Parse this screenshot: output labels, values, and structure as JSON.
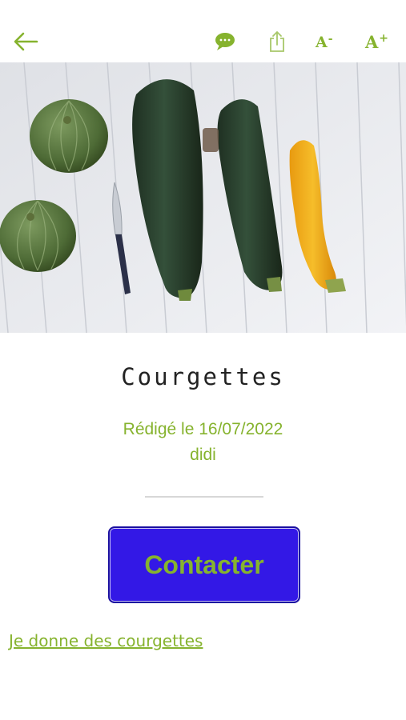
{
  "toolbar": {
    "font_smaller": "A",
    "font_smaller_sup": "-",
    "font_larger": "A",
    "font_larger_sup": "+"
  },
  "colors": {
    "accent_green": "#86b32e",
    "button_blue": "#3318e6"
  },
  "icons": [
    "back-arrow-icon",
    "chat-bubble-icon",
    "share-icon",
    "decrease-font-icon",
    "increase-font-icon"
  ],
  "article": {
    "title": "Courgettes",
    "date": "Rédigé le 16/07/2022",
    "author": "didi",
    "contact_label": "Contacter",
    "link_text": "Je donne des courgettes"
  }
}
